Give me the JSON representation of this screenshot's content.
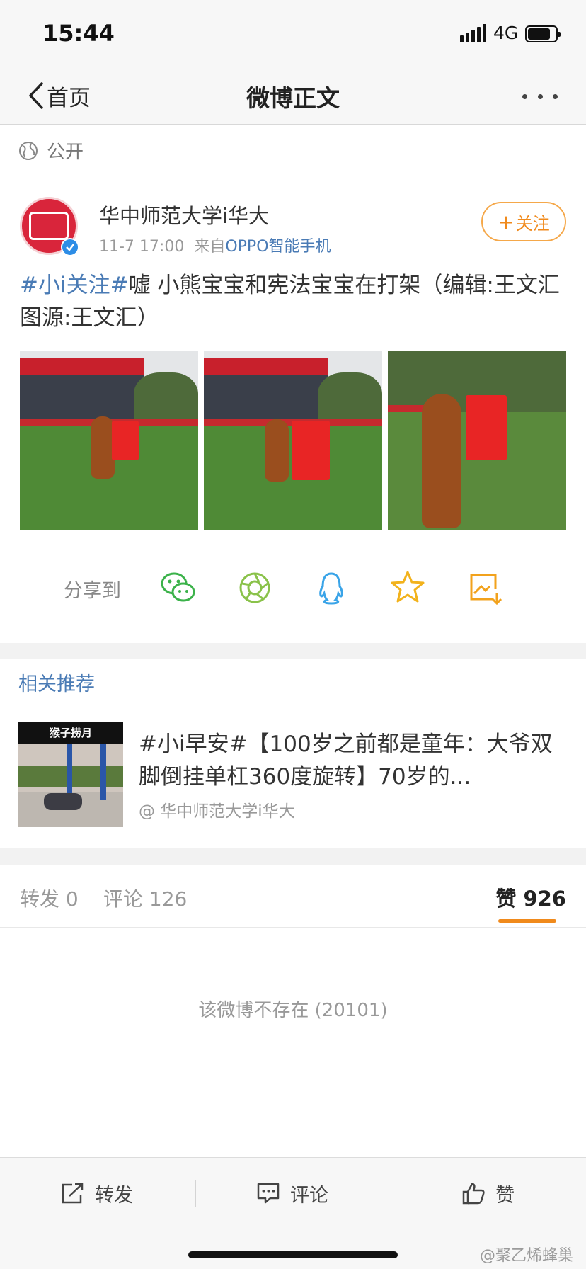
{
  "status_bar": {
    "time": "15:44",
    "network": "4G"
  },
  "nav": {
    "back_label": "首页",
    "title": "微博正文"
  },
  "visibility": {
    "label": "公开"
  },
  "author": {
    "name": "华中师范大学i华大",
    "time": "11-7 17:00",
    "source_prefix": "来自",
    "source": "OPPO智能手机",
    "follow_label": "关注"
  },
  "post": {
    "tag": "#小i关注#",
    "text": "嘘  小熊宝宝和宪法宝宝在打架（编辑:王文汇 图源:王文汇）"
  },
  "share": {
    "label": "分享到",
    "icons": [
      "wechat-icon",
      "moments-icon",
      "qq-icon",
      "qzone-icon",
      "save-image-icon"
    ]
  },
  "recommend": {
    "title": "相关推荐",
    "thumb_label": "猴子捞月",
    "text": "#小i早安#【100岁之前都是童年：大爷双脚倒挂单杠360度旋转】70岁的...",
    "author": "@ 华中师范大学i华大"
  },
  "tabs": {
    "repost": "转发 0",
    "comment": "评论 126",
    "like": "赞 926"
  },
  "empty_message": "该微博不存在 (20101)",
  "toolbar": {
    "repost": "转发",
    "comment": "评论",
    "like": "赞"
  },
  "watermark": "@聚乙烯蜂巢",
  "colors": {
    "accent": "#f08a1c",
    "link": "#4a7bb5",
    "verified": "#2d8de6"
  }
}
